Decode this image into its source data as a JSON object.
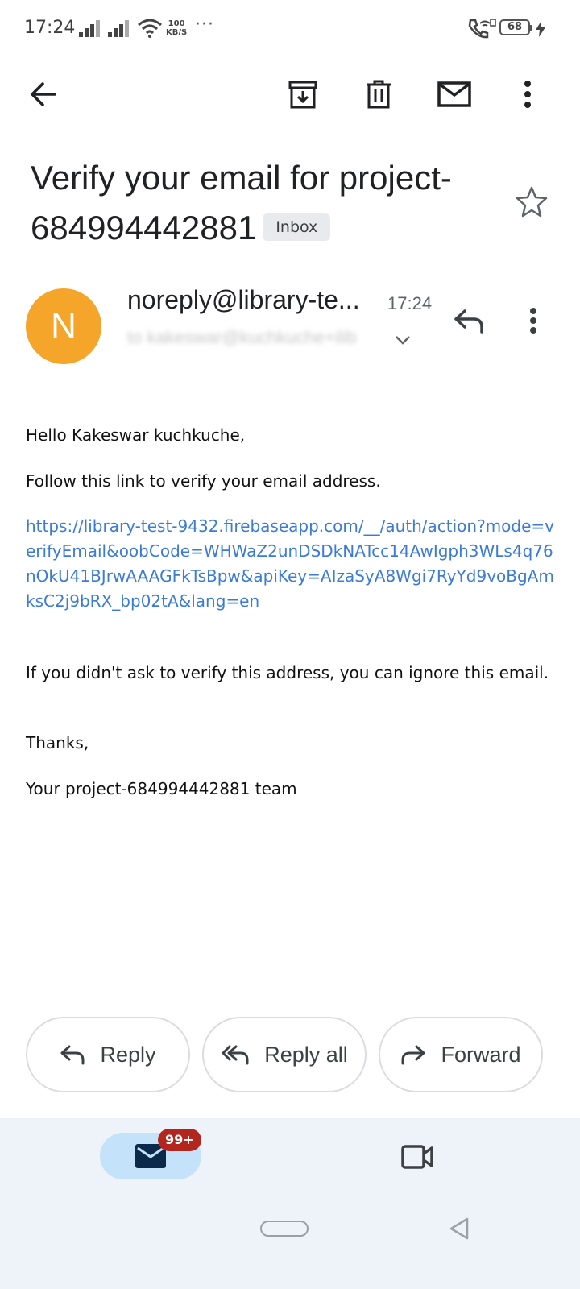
{
  "status_bar": {
    "time": "17:24",
    "net_speed_value": "100",
    "net_speed_unit": "KB/S",
    "more": "···",
    "battery": "68"
  },
  "toolbar": {
    "back_icon": "arrow-back-icon",
    "archive_icon": "archive-icon",
    "delete_icon": "trash-icon",
    "unread_icon": "mail-icon",
    "more_icon": "more-vert-icon"
  },
  "email": {
    "subject": "Verify your email for project-684994442881",
    "label": "Inbox",
    "sender_initial": "N",
    "sender": "noreply@library-te...",
    "time": "17:24",
    "recipient": "to kakeswar@kuchkuche+ilib",
    "avatar_color": "#f4a52a",
    "body": {
      "greeting": "Hello Kakeswar kuchkuche,",
      "instruction": "Follow this link to verify your email address.",
      "link": "https://library-test-9432.firebaseapp.com/__/auth/action?mode=verifyEmail&oobCode=WHWaZ2unDSDkNATcc14AwIgph3WLs4q76nOkU41BJrwAAAGFkTsBpw&apiKey=AIzaSyA8Wgi7RyYd9voBgAmksC2j9bRX_bp02tA&lang=en",
      "ignore_note": "If you didn't ask to verify this address, you can ignore this email.",
      "thanks": "Thanks,",
      "signature": "Your project-684994442881 team"
    }
  },
  "actions": {
    "reply": "Reply",
    "reply_all": "Reply all",
    "forward": "Forward"
  },
  "bottom_nav": {
    "mail_badge": "99+",
    "accent": "#c5e2fb"
  }
}
